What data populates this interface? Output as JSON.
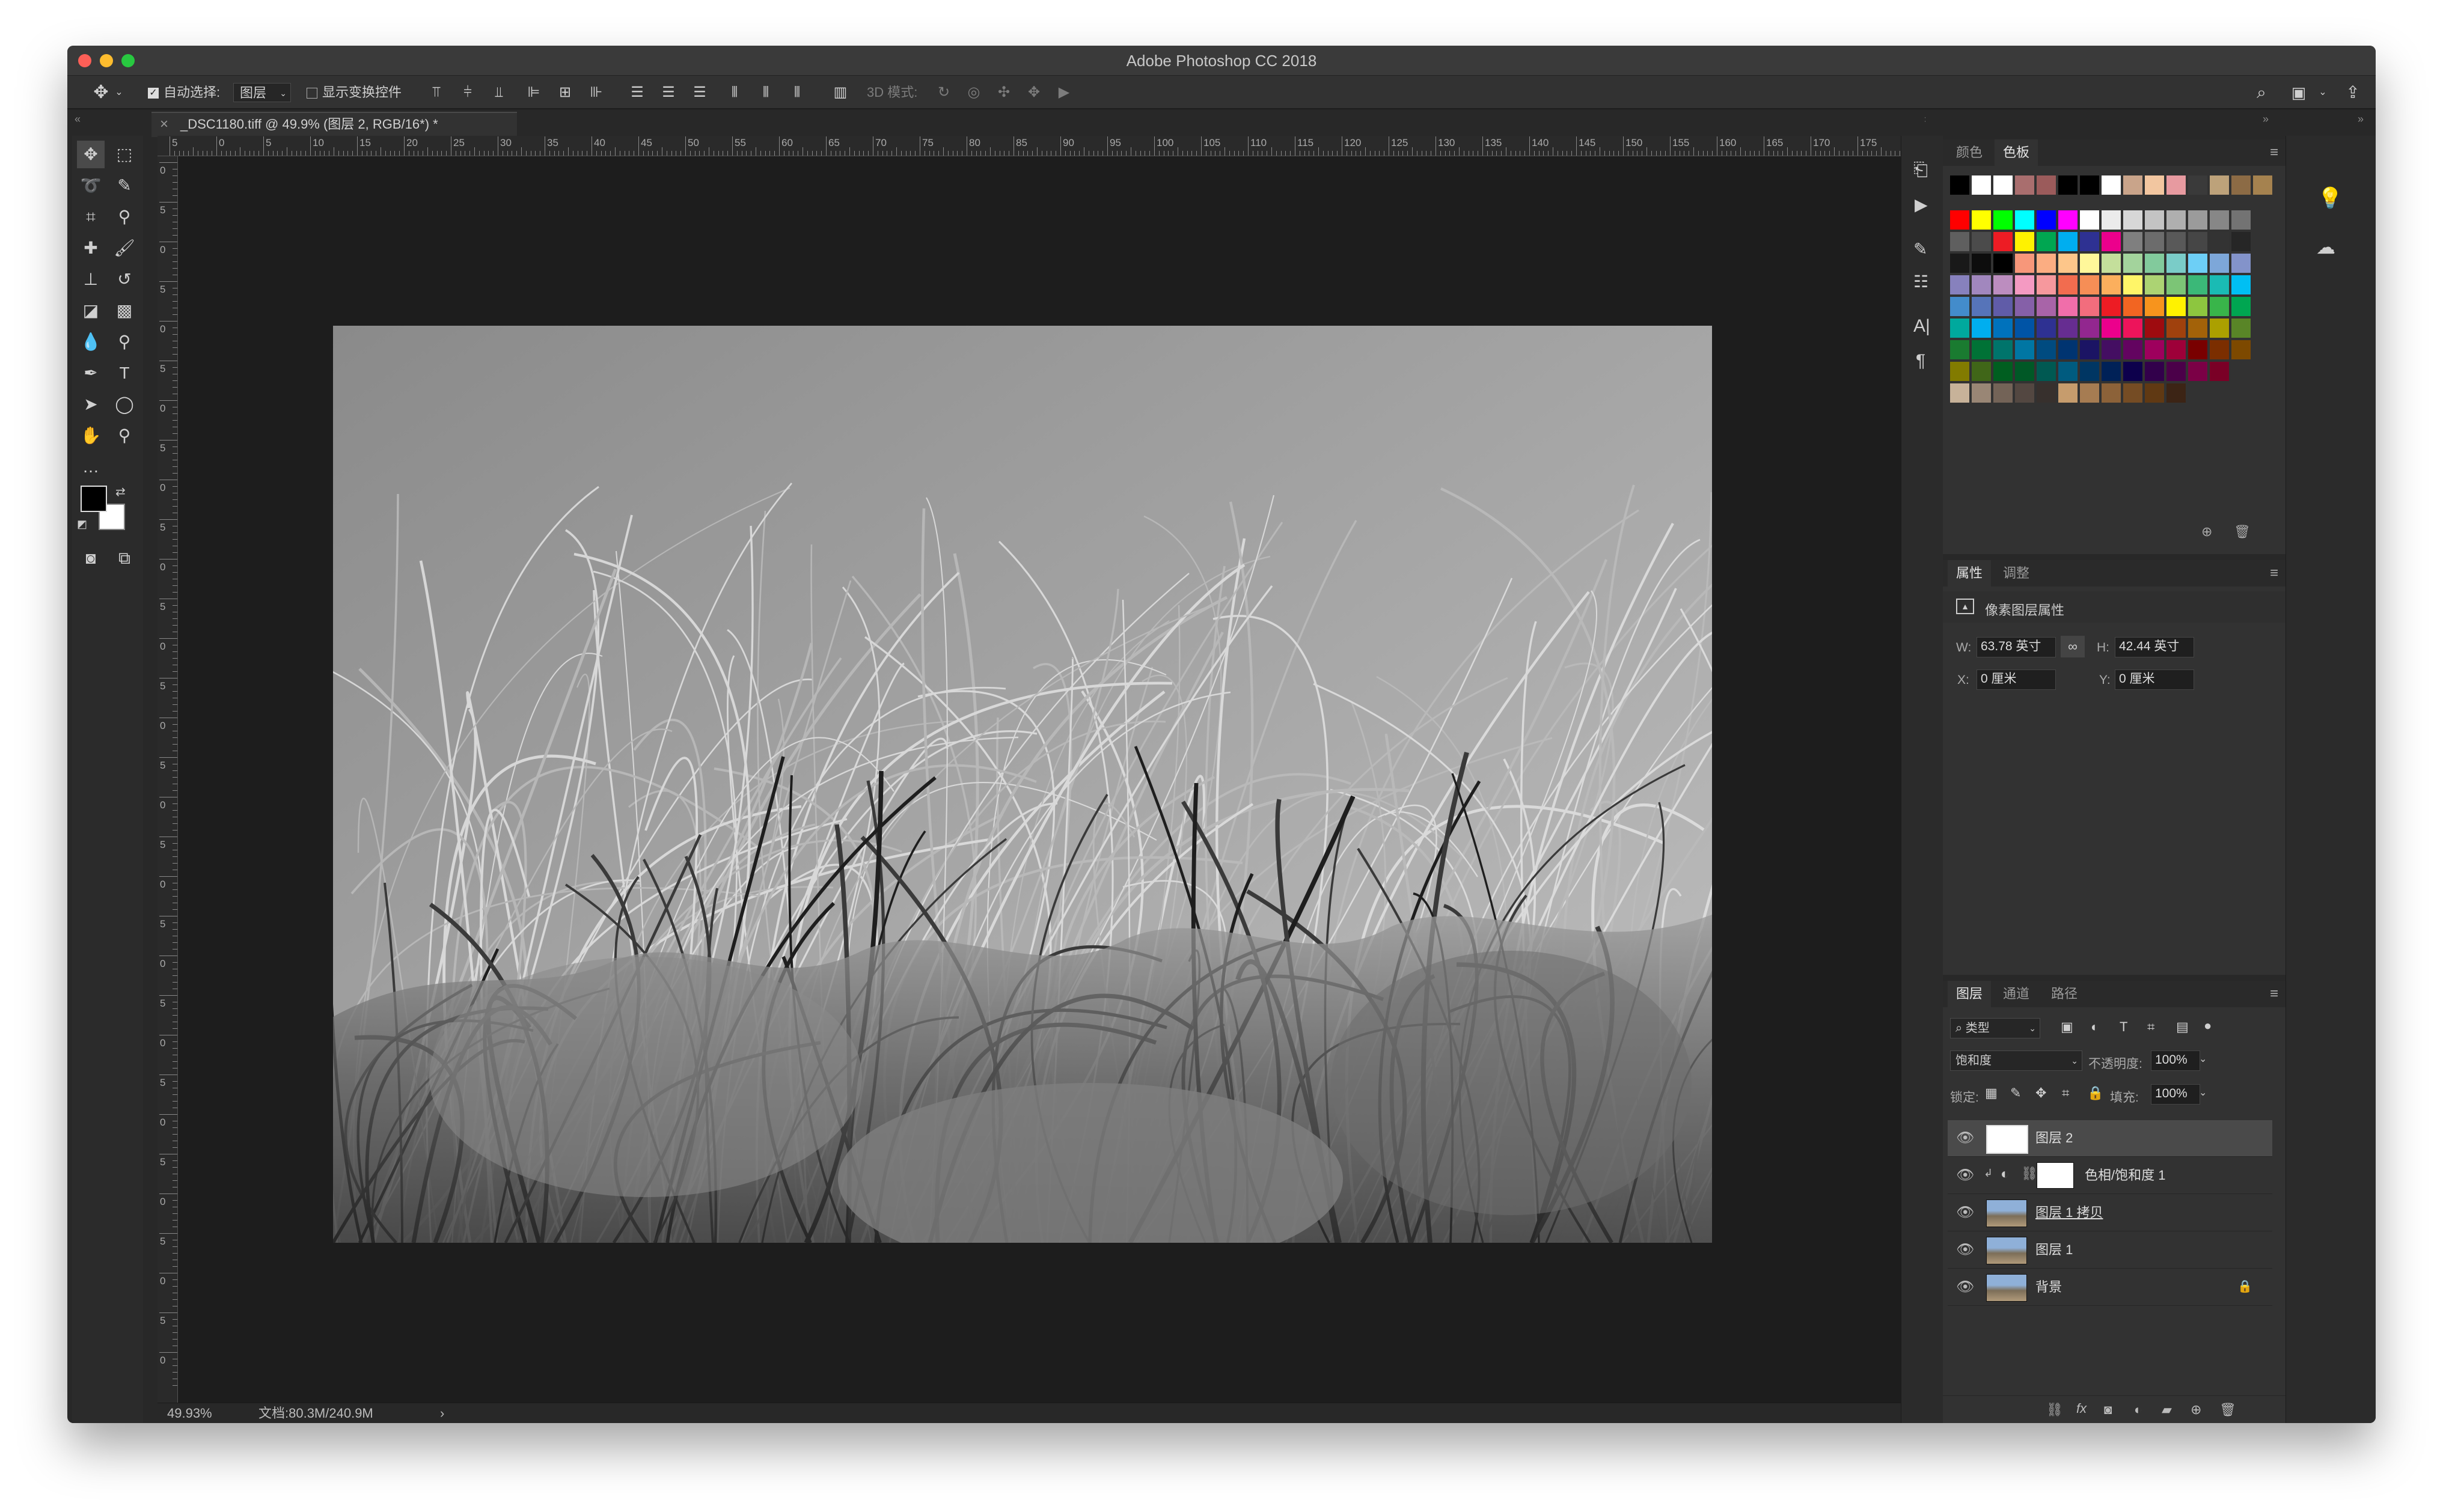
{
  "window": {
    "title": "Adobe Photoshop CC 2018",
    "traffic_colors": [
      "#fc5f57",
      "#fdbc2e",
      "#28c840"
    ]
  },
  "options_bar": {
    "auto_select_label": "自动选择:",
    "auto_select_value": "图层",
    "show_transform_label": "显示变换控件",
    "mode3d_label": "3D 模式:"
  },
  "document": {
    "tab_title": "_DSC1180.tiff @ 49.9% (图层 2, RGB/16*) *"
  },
  "ruler": {
    "top_labels": [
      "5",
      "0",
      "5",
      "10",
      "15",
      "20",
      "25",
      "30",
      "35",
      "40",
      "45",
      "50",
      "55",
      "60",
      "65",
      "70",
      "75",
      "80",
      "85",
      "90",
      "95",
      "100",
      "105",
      "110",
      "115",
      "120",
      "125",
      "130",
      "135",
      "140",
      "145",
      "150",
      "155",
      "160",
      "165",
      "170",
      "175"
    ],
    "left_labels": [
      "0",
      "5",
      "0",
      "5",
      "0",
      "5",
      "0",
      "5",
      "0",
      "5",
      "0",
      "5",
      "0",
      "5",
      "0",
      "5",
      "0",
      "5",
      "0",
      "5",
      "0",
      "5",
      "0",
      "5",
      "0",
      "5",
      "0",
      "5",
      "0",
      "5",
      "0"
    ]
  },
  "status": {
    "zoom": "49.93%",
    "doc_size": "文档:80.3M/240.9M",
    "arrow": "›"
  },
  "swatches_panel": {
    "tabs": [
      "颜色",
      "色板"
    ],
    "active_tab": "色板",
    "recent": [
      "#000000",
      "#ffffff",
      "#ffffff",
      "#a96e6e",
      "#9b5b5b",
      "#000000",
      "#000000",
      "#ffffff",
      "#c9a48a",
      "#f2c6a0",
      "#e79aa0",
      "#3a3a3a",
      "#bda27a",
      "#8c6b45",
      "#a5824f"
    ],
    "rows": [
      [
        "#ff0000",
        "#ffff00",
        "#00ff00",
        "#00ffff",
        "#0000ff",
        "#ff00ff",
        "#ffffff",
        "#ebebeb",
        "#d7d7d7",
        "#c3c3c3",
        "#afafaf",
        "#9b9b9b",
        "#878787",
        "#737373"
      ],
      [
        "#5f5f5f",
        "#4b4b4b",
        "#ed1c24",
        "#fff200",
        "#00a651",
        "#00aeef",
        "#2e3192",
        "#ec008c",
        "#7f7f7f",
        "#6c6c6c",
        "#595959",
        "#464646",
        "#333333",
        "#262626"
      ],
      [
        "#191919",
        "#0d0d0d",
        "#000000",
        "#f7977a",
        "#fbad82",
        "#fdc68a",
        "#fff79a",
        "#c4df9b",
        "#a3d39c",
        "#82ca9c",
        "#7accc8",
        "#6dcff6",
        "#7da7d9",
        "#8393ca"
      ],
      [
        "#8781bd",
        "#a187be",
        "#bc8dbf",
        "#f49ac2",
        "#f6989d",
        "#f26c4f",
        "#f68e56",
        "#fbaf5d",
        "#fff568",
        "#acd373",
        "#7cc576",
        "#3bb878",
        "#1abbb4",
        "#00bff3"
      ],
      [
        "#438ccb",
        "#5674b9",
        "#605ca8",
        "#8560a8",
        "#a864a8",
        "#f06eaa",
        "#f26d7d",
        "#ed1c24",
        "#f26522",
        "#f7941d",
        "#fff200",
        "#8dc63f",
        "#39b54a",
        "#00a651"
      ],
      [
        "#00a99d",
        "#00aeef",
        "#0072bc",
        "#0054a6",
        "#2e3192",
        "#662d91",
        "#92278f",
        "#ec008c",
        "#ed145b",
        "#9e0b0f",
        "#a0410d",
        "#a36209",
        "#aba000",
        "#598527"
      ],
      [
        "#1a7b30",
        "#007236",
        "#00746b",
        "#0076a3",
        "#004b80",
        "#003471",
        "#1b1464",
        "#440e62",
        "#630460",
        "#9e005d",
        "#9e0039",
        "#790000",
        "#7b2e00",
        "#7d4900"
      ],
      [
        "#827b00",
        "#406618",
        "#005e20",
        "#005826",
        "#005952",
        "#005b7f",
        "#003663",
        "#002157",
        "#0d004c",
        "#32004b",
        "#4b0049",
        "#7b0046",
        "#7a0026"
      ],
      [
        "#c7b299",
        "#998675",
        "#736357",
        "#534741",
        "#37302d",
        "#c69c6d",
        "#a67c52",
        "#8c6239",
        "#754c24",
        "#603913",
        "#3c2415"
      ]
    ]
  },
  "properties_panel": {
    "tabs": [
      "属性",
      "调整"
    ],
    "active_tab": "属性",
    "header": "像素图层属性",
    "w_label": "W:",
    "w_value": "63.78 英寸",
    "h_label": "H:",
    "h_value": "42.44 英寸",
    "x_label": "X:",
    "x_value": "0 厘米",
    "y_label": "Y:",
    "y_value": "0 厘米"
  },
  "layers_panel": {
    "tabs": [
      "图层",
      "通道",
      "路径"
    ],
    "active_tab": "图层",
    "filter_label": "类型",
    "blend_mode": "饱和度",
    "opacity_label": "不透明度:",
    "opacity_value": "100%",
    "lock_label": "锁定:",
    "fill_label": "填充:",
    "fill_value": "100%",
    "layers": [
      {
        "name": "图层 2",
        "selected": true
      },
      {
        "name": "色相/饱和度 1",
        "selected": false
      },
      {
        "name": "图层 1 拷贝",
        "selected": false
      },
      {
        "name": "图层 1",
        "selected": false
      },
      {
        "name": "背景",
        "selected": false
      }
    ]
  },
  "icons": {
    "eye": "👁",
    "lock": "🔒",
    "menu": "≡",
    "close": "×"
  }
}
